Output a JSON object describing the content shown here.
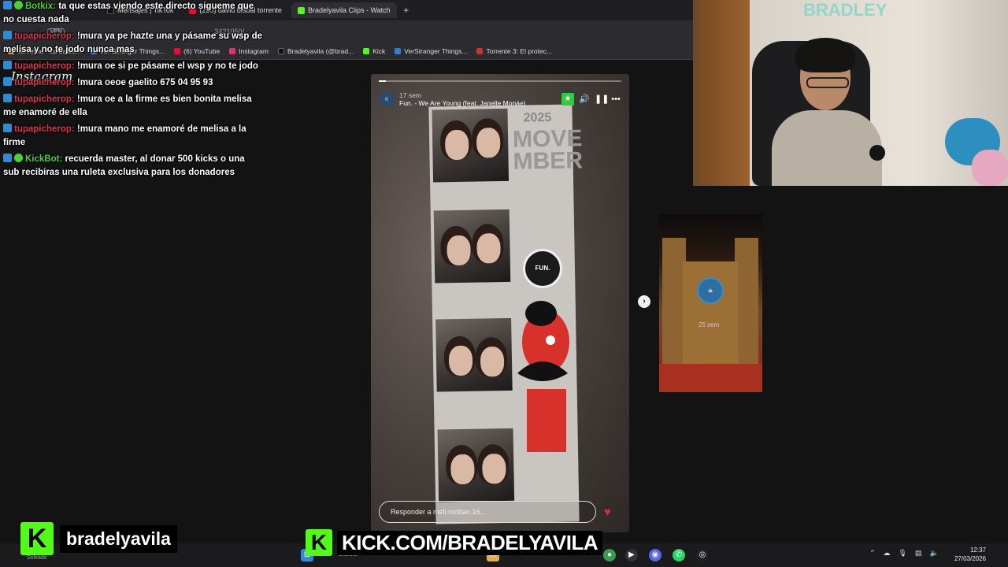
{
  "browser": {
    "tabs": [
      {
        "label": "Mensajes | TikTok",
        "color": "#111111"
      },
      {
        "label": "(230) david bisbal torrente",
        "color": "#ff0033"
      },
      {
        "label": "Bradelyavila Clips - Watch",
        "color": "#53fc18"
      }
    ],
    "url": "3421050/",
    "vpn_badge": "VPN",
    "bookmarks": [
      {
        "label": "survev.io - 2d battle...",
        "color": "#c8a04a"
      },
      {
        "label": "Ver Stranger Things...",
        "color": "#3a7bd5"
      },
      {
        "label": "(6) YouTube",
        "color": "#ff0033"
      },
      {
        "label": "Instagram",
        "color": "#e1306c"
      },
      {
        "label": "Bradelyavila (@brad...",
        "color": "#111111"
      },
      {
        "label": "Kick",
        "color": "#53fc18"
      },
      {
        "label": "VerStranger Things...",
        "color": "#3a7bd5"
      },
      {
        "label": "Torrente 3: El protec...",
        "color": "#c0392b"
      }
    ]
  },
  "instagram_logo": "Instagram",
  "chat": [
    {
      "user": "Botkix:",
      "text": "ta que estas viendo este directo sigueme que no cuesta nada",
      "green": true
    },
    {
      "user": "tupapicherop:",
      "text": "!mura ya pe hazte una y pásame su wsp de melisa y no te jodo nunca mas",
      "green": false
    },
    {
      "user": "tupapicherop:",
      "text": "!mura oe si pe pásame el wsp y no te jodo",
      "green": false
    },
    {
      "user": "tupapicherop:",
      "text": "!mura oeoe gaelito 675 04 95 93",
      "green": false
    },
    {
      "user": "tupapicherop:",
      "text": "!mura oe a la firme es bien bonita melisa me enamoré de ella",
      "green": false
    },
    {
      "user": "tupapicherop:",
      "text": "!mura mano me enamoré de melisa a la firme",
      "green": false
    },
    {
      "user": "KickBot:",
      "text": "recuerda master, al donar 500 kicks o una sub recibiras una ruleta exclusiva para los donadores",
      "green": true
    }
  ],
  "story": {
    "progress": 0.03,
    "avatar_letter": "e",
    "time": "17 sem",
    "song": "Fun. - We Are Young (feat. Janelle Monáe)",
    "strip_year": "2025",
    "strip_title": "MOVE MBER",
    "vinyl_label": "FUN.",
    "reply_placeholder": "Responder a meli.roddan.16..."
  },
  "side_story": {
    "time": "25 sem"
  },
  "webcam": {
    "brand_text": "BRADLEY"
  },
  "overlay": {
    "kick_letter": "K",
    "channel_name": "bradelyavila",
    "url": "KICK.COM/BRADELYAVILA"
  },
  "taskbar": {
    "search_label": "Buscar",
    "weather_label": "Soleado",
    "time": "12:37",
    "date": "27/03/2026"
  }
}
